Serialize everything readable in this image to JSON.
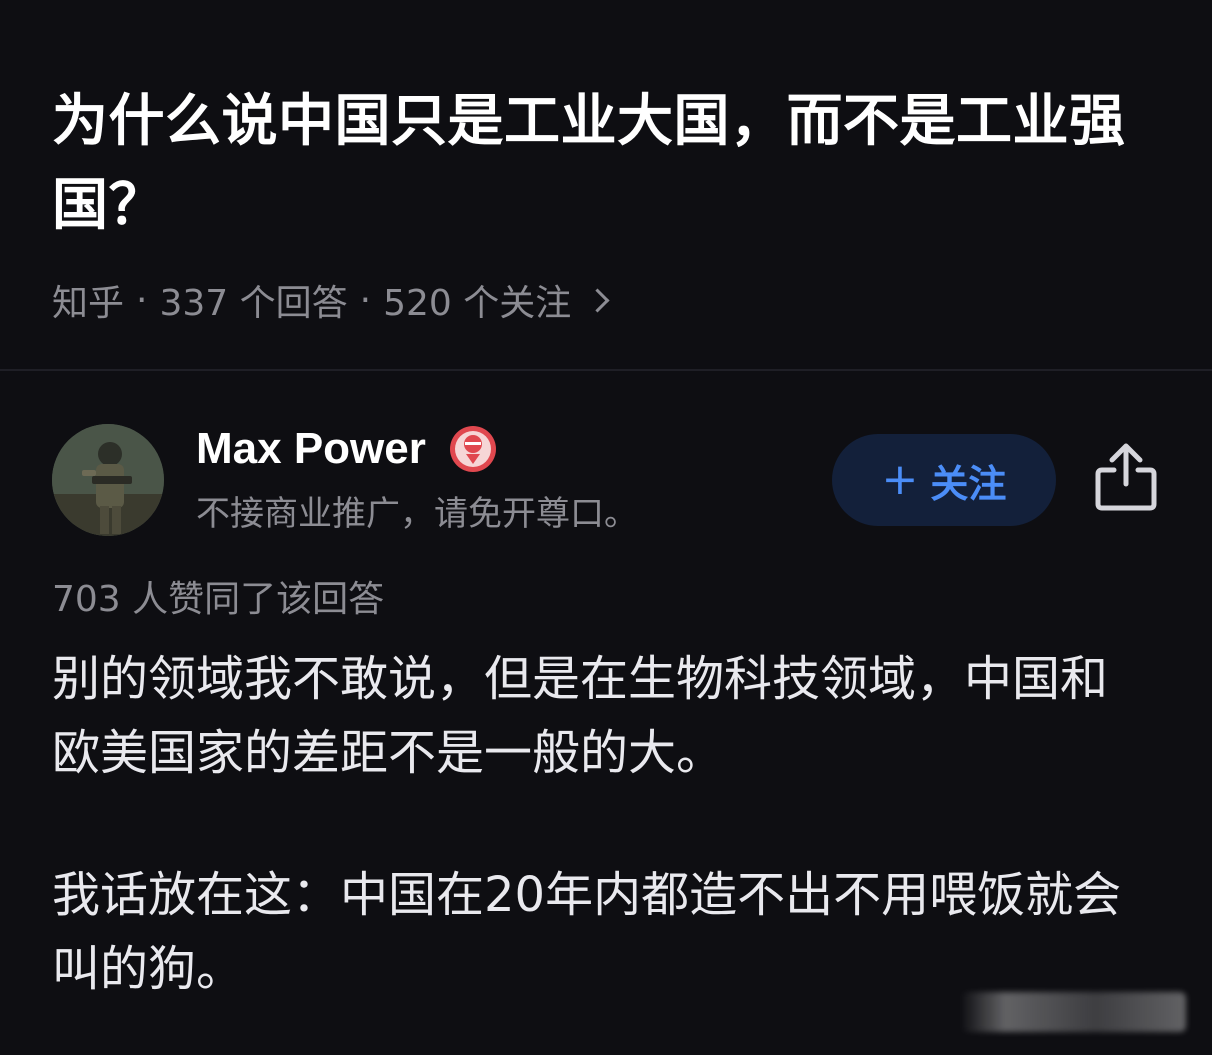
{
  "question": {
    "title": "为什么说中国只是工业大国，而不是工业强国？",
    "source": "知乎",
    "separator": "·",
    "answers_count": "337 个回答",
    "followers_count": "520 个关注"
  },
  "author": {
    "name": "Max Power",
    "bio": "不接商业推广，请免开尊口。",
    "avatar_icon": "avatar-soldier",
    "badge_icon": "badge-icon",
    "follow_plus": "+",
    "follow_label": "关注"
  },
  "answer": {
    "votes": "703 人赞同了该回答",
    "paragraphs": [
      "别的领域我不敢说，但是在生物科技领域，中国和欧美国家的差距不是一般的大。",
      "我话放在这：中国在20年内都造不出不用喂饭就会叫的狗。"
    ]
  },
  "colors": {
    "background": "#0e0e12",
    "muted_text": "#8c8c93",
    "accent_blue": "#4b8df7",
    "follow_bg": "#13203a",
    "badge_red": "#e0484f"
  }
}
